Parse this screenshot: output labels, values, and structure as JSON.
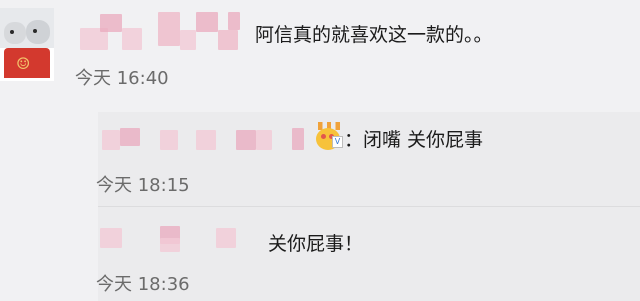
{
  "comment": {
    "avatar_icon": "dog-pair-avatar",
    "text": "阿信真的就喜欢这一款的。。",
    "time": "今天 16:40"
  },
  "replies": [
    {
      "badge_icon": "crown-face-emoji",
      "text": "：闭嘴 关你屁事",
      "time": "今天 18:15"
    },
    {
      "text": "关你屁事！",
      "time": "今天 18:36"
    }
  ],
  "colors": {
    "background": "#f1f1f3",
    "reply_background": "#ebebed",
    "blur_pink": "#e9a9bd",
    "text": "#1b1b1b",
    "time": "#6b6b6b"
  }
}
